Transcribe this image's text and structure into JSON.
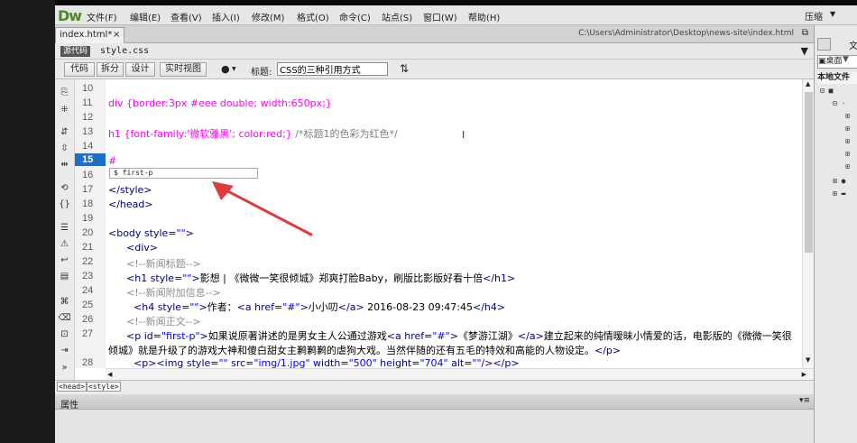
{
  "app": {
    "logo": "Dw"
  },
  "menu": [
    "文件(F)",
    "编辑(E)",
    "查看(V)",
    "插入(I)",
    "修改(M)",
    "格式(O)",
    "命令(C)",
    "站点(S)",
    "窗口(W)",
    "帮助(H)"
  ],
  "topright": {
    "compress": "压缩",
    "arrow": "▼"
  },
  "tabs": {
    "active_label": "index.html*",
    "close": "×",
    "file_path": "C:\\Users\\Administrator\\Desktop\\news-site\\index.html",
    "restore": "⧉"
  },
  "related": {
    "source_code": "源代码",
    "style_css": "style.css",
    "filter": "▼"
  },
  "toolbar": {
    "code": "代码",
    "split": "拆分",
    "design": "设计",
    "live_view": "实时视图",
    "title_label": "标题:",
    "title_value": "CSS的三种引用方式",
    "globe": "●",
    "down": "▼",
    "sort": "⇅"
  },
  "code_hint": "$ first-p",
  "line_numbers": [
    "10",
    "11",
    "12",
    "13",
    "14",
    "15",
    "16",
    "17",
    "18",
    "19",
    "20",
    "21",
    "22",
    "23",
    "24",
    "25",
    "26",
    "27",
    "",
    "28"
  ],
  "code_lines": {
    "l11a": "div {border:3px #eee double; width:650px;}",
    "l13_sel": "h1 {",
    "l13_p1": "font-family:",
    "l13_v1": "'微软雅黑'",
    "l13_p2": "; color:",
    "l13_v2": "red",
    "l13_end": ";}",
    "l13_cm": " /*标题1的色彩为红色*/",
    "l15": "#",
    "l17": "</style>",
    "l18": "</head>",
    "l20_tag": "<body ",
    "l20_at": "style=",
    "l20_av": "\"\"",
    "l20_end": ">",
    "l21": "<div>",
    "l22": "<!--新闻标题-->",
    "l23_tag": "<h1 ",
    "l23_at": "style=",
    "l23_av": "\"\"",
    "l23_gt": ">",
    "l23_txt": "影想 | 《微微一笑很倾城》郑爽打脸Baby，刷版比影版好看十倍",
    "l23_close": "</h1>",
    "l24": "<!--新闻附加信息-->",
    "l25_tag": "<h4 ",
    "l25_at": "style=",
    "l25_av": "\"\"",
    "l25_gt": ">",
    "l25_txt": "作者：",
    "l25_a": "<a ",
    "l25_href": "href=",
    "l25_hv": "\"#\"",
    "l25_agt": ">",
    "l25_name": "小小叨",
    "l25_aclose": "</a>",
    "l25_date": " 2016-08-23 09:47:45",
    "l25_close": "</h4>",
    "l26": "<!--新闻正文-->",
    "l27_tag": "<p ",
    "l27_at": "id=",
    "l27_av": "\"first-p\"",
    "l27_gt": ">",
    "l27_txt": "如果说原著讲述的是男女主人公通过游戏",
    "l27_a": "<a ",
    "l27_href": "href=",
    "l27_hv": "\"#\"",
    "l27_agt": ">",
    "l27_link": "《梦游江湖》",
    "l27_aclose": "</a>",
    "l27_rest": "建立起来的纯情暧昧小情爱的话，电影版的《微微一笑很",
    "l27b_txt": "倾城》就是升级了的游戏大神和傻白甜女主鹣鹣鹣的虐狗大戏。当然伴随的还有五毛的特效和高能的人物设定。",
    "l27b_close": "</p>",
    "l28_tag": "<p>",
    "l28_img": "<img ",
    "l28_at1": "style=",
    "l28_av1": "\"\"",
    "l28_at2": " src=",
    "l28_av2": "\"img/1.jpg\"",
    "l28_at3": " width=",
    "l28_av3": "\"500\"",
    "l28_at4": " height=",
    "l28_av4": "\"704\"",
    "l28_at5": " alt=",
    "l28_av5": "\"\"",
    "l28_end": "/></p>"
  },
  "tag_selector": [
    "<head>",
    "<style>"
  ],
  "properties": {
    "label": "属性",
    "menu": "▾≡"
  },
  "right_panel": {
    "tab": "文",
    "desktop": "桌面",
    "local_files": "本地文件",
    "funnel": "▼"
  },
  "colors": {
    "accent": "#1e6fc8",
    "arrow": "#e03b3b",
    "logo": "#4a8b2a"
  }
}
